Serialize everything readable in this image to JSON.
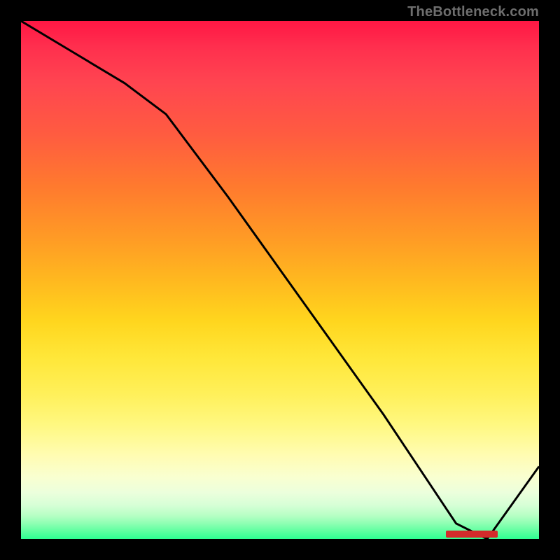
{
  "watermark": "TheBottleneck.com",
  "chart_data": {
    "type": "line",
    "title": "",
    "xlabel": "",
    "ylabel": "",
    "ylim": [
      0,
      100
    ],
    "xlim": [
      0,
      100
    ],
    "x": [
      0,
      10,
      20,
      28,
      40,
      50,
      60,
      70,
      78,
      84,
      90,
      100
    ],
    "values": [
      100,
      94,
      88,
      82,
      66,
      52,
      38,
      24,
      12,
      3,
      0,
      14
    ],
    "series_name": "bottleneck-curve",
    "highlight": {
      "x_start": 82,
      "x_end": 92,
      "y": 0
    },
    "background_gradient": {
      "stops": [
        {
          "pct": 0,
          "color": "#ff1744"
        },
        {
          "pct": 50,
          "color": "#ffb81f"
        },
        {
          "pct": 78,
          "color": "#fff881"
        },
        {
          "pct": 100,
          "color": "#2eff91"
        }
      ]
    }
  }
}
